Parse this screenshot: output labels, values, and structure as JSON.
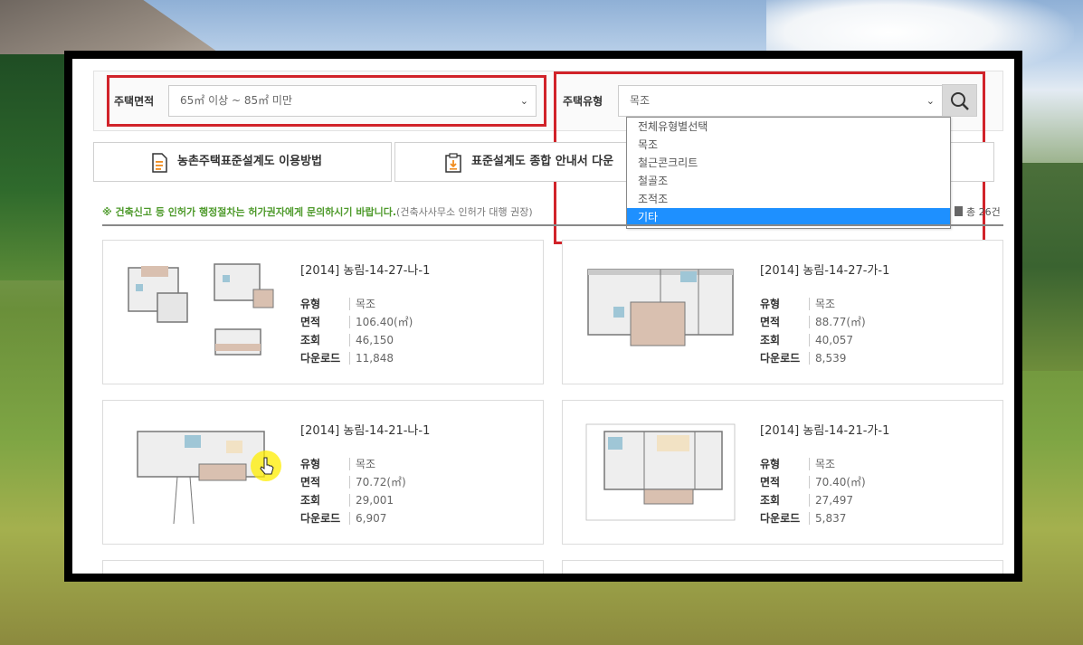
{
  "filters": {
    "area_label": "주택면적",
    "area_value": "65㎡ 이상 ~ 85㎡ 미만",
    "type_label": "주택유형",
    "type_value": "목조"
  },
  "dropdown": {
    "options": [
      "전체유형별선택",
      "목조",
      "철근콘크리트",
      "철골조",
      "조적조",
      "기타"
    ],
    "selected_index": 5
  },
  "guide_buttons": {
    "usage": "농촌주택표준설계도 이용방법",
    "download": "표준설계도 종합 안내서 다운"
  },
  "notice": {
    "main": "※ 건축신고 등 인허가 행정절차는 허가권자에게 문의하시기 바랍니다.",
    "sub": "(건축사사무소 인허가 대행 권장)"
  },
  "total_count": "총 26건",
  "field_labels": {
    "type": "유형",
    "area": "면적",
    "views": "조회",
    "downloads": "다운로드"
  },
  "cards": [
    {
      "title": "[2014] 농림-14-27-나-1",
      "type": "목조",
      "area": "106.40(㎡)",
      "views": "46,150",
      "downloads": "11,848"
    },
    {
      "title": "[2014] 농림-14-27-가-1",
      "type": "목조",
      "area": "88.77(㎡)",
      "views": "40,057",
      "downloads": "8,539"
    },
    {
      "title": "[2014] 농림-14-21-나-1",
      "type": "목조",
      "area": "70.72(㎡)",
      "views": "29,001",
      "downloads": "6,907"
    },
    {
      "title": "[2014] 농림-14-21-가-1",
      "type": "목조",
      "area": "70.40(㎡)",
      "views": "27,497",
      "downloads": "5,837"
    }
  ],
  "colors": {
    "highlight_red": "#d1232a",
    "selected_blue": "#1e90ff",
    "notice_green": "#4e9a2b"
  }
}
